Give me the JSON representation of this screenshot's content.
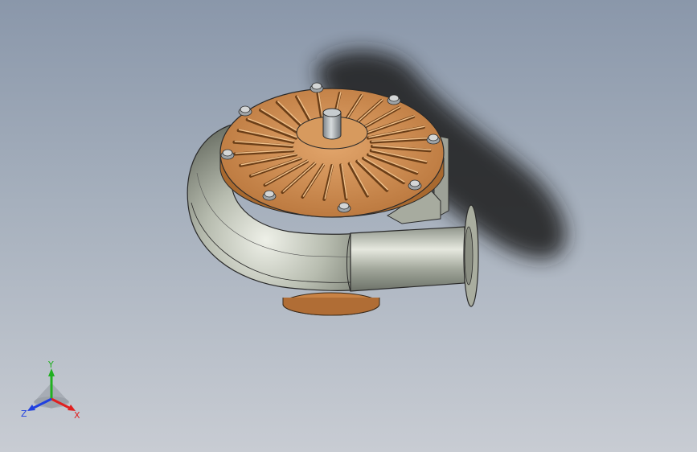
{
  "viewport": {
    "background_top": "#8a97aa",
    "background_bottom": "#c8ccd3"
  },
  "model": {
    "volute_color": "#b9bdb0",
    "impeller_color": "#c98a4e",
    "shaft_color": "#a9afb3",
    "bolt_color": "#d4d6d6"
  },
  "triad": {
    "x_label": "X",
    "y_label": "Y",
    "z_label": "Z",
    "x_color": "#e02020",
    "y_color": "#20b020",
    "z_color": "#2040e0"
  }
}
